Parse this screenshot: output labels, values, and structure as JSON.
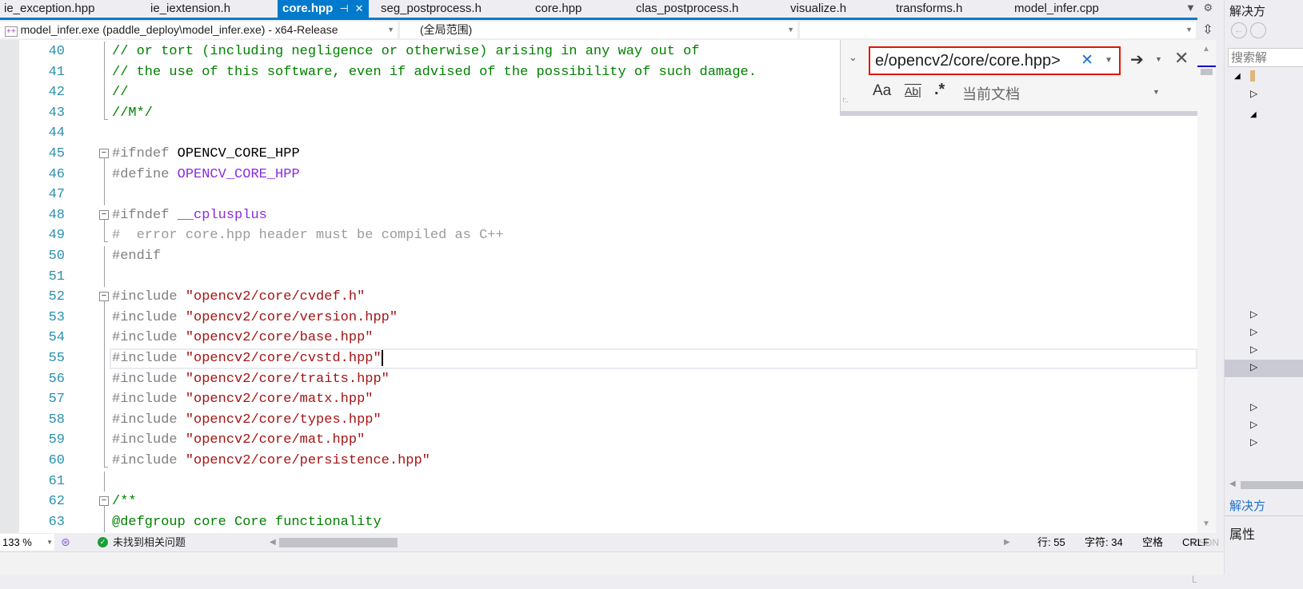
{
  "tabs": [
    {
      "label": "ie_exception.hpp"
    },
    {
      "label": "ie_iextension.h"
    },
    {
      "label": "core.hpp",
      "active": true
    },
    {
      "label": "seg_postprocess.h"
    },
    {
      "label": "core.hpp"
    },
    {
      "label": "clas_postprocess.h"
    },
    {
      "label": "visualize.h"
    },
    {
      "label": "transforms.h"
    },
    {
      "label": "model_infer.cpp"
    }
  ],
  "nav": {
    "project": "model_infer.exe (paddle_deploy\\model_infer.exe) - x64-Release",
    "scope": "(全局范围)",
    "member": ""
  },
  "find": {
    "query": "e/opencv2/core/core.hpp>",
    "scope": "当前文档",
    "match_case": "Aa",
    "whole_word": "Ab|",
    "regex": ".*"
  },
  "code": [
    {
      "n": "40",
      "fold": "cont",
      "tokens": [
        [
          "comment",
          "// or tort (including negligence or otherwise) arising in any way out of"
        ]
      ]
    },
    {
      "n": "41",
      "fold": "cont",
      "tokens": [
        [
          "comment",
          "// the use of this software, even if advised of the possibility of such damage."
        ]
      ]
    },
    {
      "n": "42",
      "fold": "cont",
      "tokens": [
        [
          "comment",
          "//"
        ]
      ]
    },
    {
      "n": "43",
      "fold": "end",
      "tokens": [
        [
          "comment",
          "//M*/"
        ]
      ]
    },
    {
      "n": "44",
      "fold": "",
      "tokens": []
    },
    {
      "n": "45",
      "fold": "start",
      "tokens": [
        [
          "pp",
          "#ifndef "
        ],
        [
          "plain",
          "OPENCV_CORE_HPP"
        ]
      ]
    },
    {
      "n": "46",
      "fold": "cont",
      "tokens": [
        [
          "pp",
          "#define "
        ],
        [
          "macro",
          "OPENCV_CORE_HPP"
        ]
      ]
    },
    {
      "n": "47",
      "fold": "cont",
      "tokens": []
    },
    {
      "n": "48",
      "fold": "start",
      "tokens": [
        [
          "pp",
          "#ifndef "
        ],
        [
          "macro",
          "__cplusplus"
        ]
      ]
    },
    {
      "n": "49",
      "fold": "end",
      "tokens": [
        [
          "inactive",
          "#  error core.hpp header must be compiled as C++"
        ]
      ]
    },
    {
      "n": "50",
      "fold": "cont",
      "tokens": [
        [
          "pp",
          "#endif"
        ]
      ]
    },
    {
      "n": "51",
      "fold": "cont",
      "tokens": []
    },
    {
      "n": "52",
      "fold": "start",
      "tokens": [
        [
          "pp",
          "#include "
        ],
        [
          "str",
          "\"opencv2/core/cvdef.h\""
        ]
      ]
    },
    {
      "n": "53",
      "fold": "cont",
      "tokens": [
        [
          "pp",
          "#include "
        ],
        [
          "str",
          "\"opencv2/core/version.hpp\""
        ]
      ]
    },
    {
      "n": "54",
      "fold": "cont",
      "tokens": [
        [
          "pp",
          "#include "
        ],
        [
          "str",
          "\"opencv2/core/base.hpp\""
        ]
      ]
    },
    {
      "n": "55",
      "fold": "cont",
      "current": true,
      "tokens": [
        [
          "pp",
          "#include "
        ],
        [
          "str",
          "\"opencv2/core/cvstd.hpp\""
        ]
      ]
    },
    {
      "n": "56",
      "fold": "cont",
      "tokens": [
        [
          "pp",
          "#include "
        ],
        [
          "str",
          "\"opencv2/core/traits.hpp\""
        ]
      ]
    },
    {
      "n": "57",
      "fold": "cont",
      "tokens": [
        [
          "pp",
          "#include "
        ],
        [
          "str",
          "\"opencv2/core/matx.hpp\""
        ]
      ]
    },
    {
      "n": "58",
      "fold": "cont",
      "tokens": [
        [
          "pp",
          "#include "
        ],
        [
          "str",
          "\"opencv2/core/types.hpp\""
        ]
      ]
    },
    {
      "n": "59",
      "fold": "cont",
      "tokens": [
        [
          "pp",
          "#include "
        ],
        [
          "str",
          "\"opencv2/core/mat.hpp\""
        ]
      ]
    },
    {
      "n": "60",
      "fold": "end",
      "tokens": [
        [
          "pp",
          "#include "
        ],
        [
          "str",
          "\"opencv2/core/persistence.hpp\""
        ]
      ]
    },
    {
      "n": "61",
      "fold": "cont",
      "tokens": []
    },
    {
      "n": "62",
      "fold": "start",
      "tokens": [
        [
          "comment",
          "/**"
        ]
      ]
    },
    {
      "n": "63",
      "fold": "cont",
      "tokens": [
        [
          "doc",
          "@defgroup core Core functionality"
        ]
      ]
    }
  ],
  "status": {
    "zoom": "133 %",
    "issues": "未找到相关问题",
    "line": "行: 55",
    "col": "字符: 34",
    "whitespace": "空格",
    "eol": "CRLF"
  },
  "watermark": "CSDN @Geek L",
  "right_panel": {
    "title": "解决方",
    "search": "搜索解",
    "footer_link": "解决方",
    "properties": "属性"
  },
  "colors": {
    "accent": "#007acc",
    "find_border": "#e51400",
    "line_number": "#2b91af",
    "comment": "#008000",
    "string": "#a31515",
    "macro": "#8a2be2"
  }
}
